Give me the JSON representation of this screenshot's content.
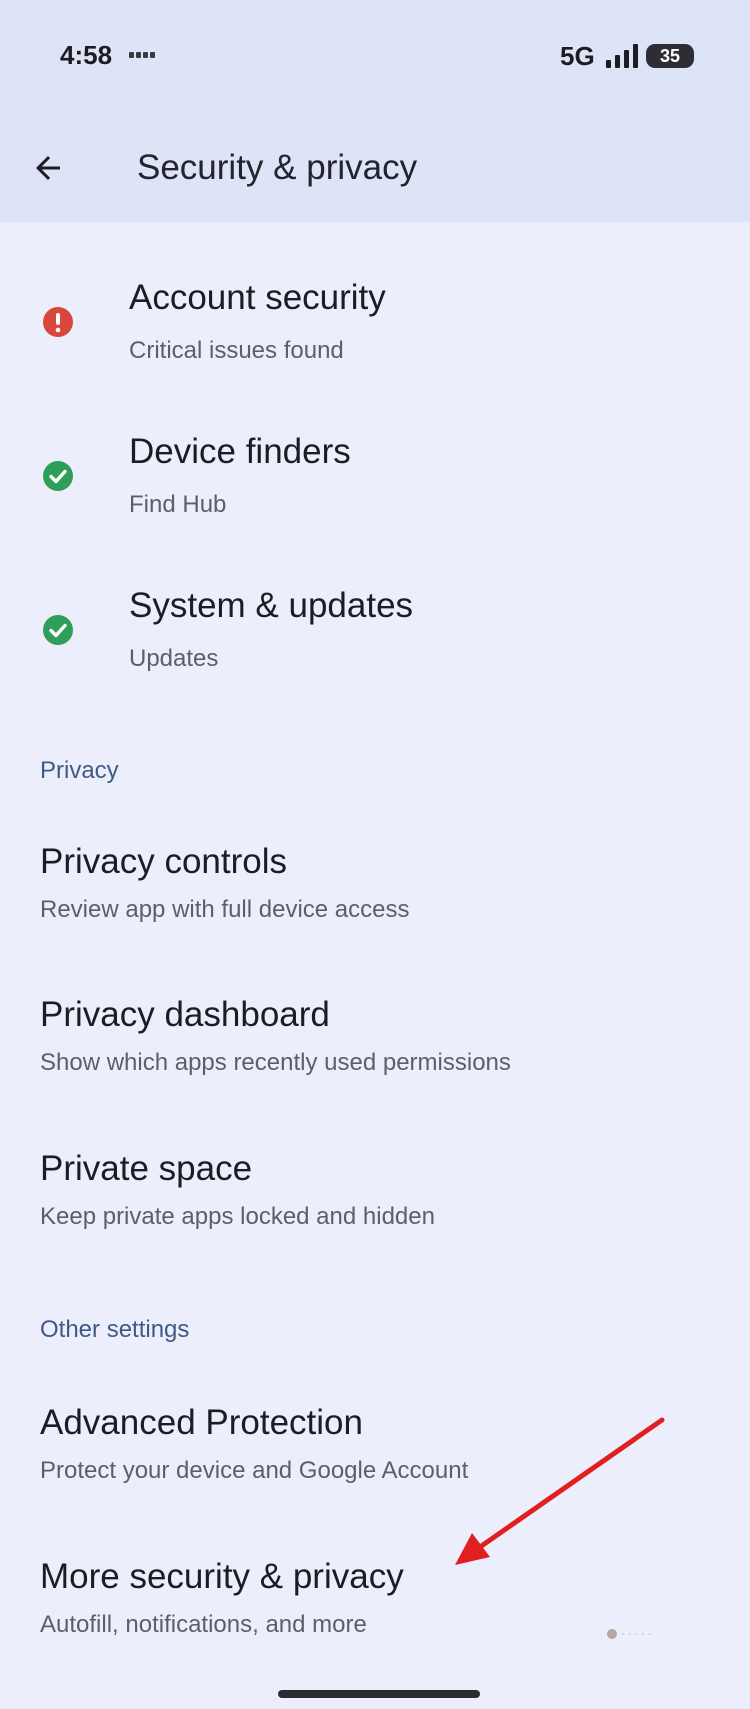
{
  "status_bar": {
    "time": "4:58",
    "network": "5G",
    "battery": "35",
    "icons": [
      "notification-icons",
      "signal-icon",
      "battery-icon"
    ]
  },
  "header": {
    "title": "Security & privacy",
    "back_icon": "arrow-left-icon"
  },
  "status_items": [
    {
      "title": "Account security",
      "subtitle": "Critical issues found",
      "icon": "alert-icon",
      "status_color": "#d9463b"
    },
    {
      "title": "Device finders",
      "subtitle": "Find Hub",
      "icon": "check-circle-icon",
      "status_color": "#2f9e59"
    },
    {
      "title": "System & updates",
      "subtitle": "Updates",
      "icon": "check-circle-icon",
      "status_color": "#2f9e59"
    }
  ],
  "sections": {
    "privacy": {
      "header": "Privacy",
      "items": [
        {
          "title": "Privacy controls",
          "subtitle": "Review app with full device access"
        },
        {
          "title": "Privacy dashboard",
          "subtitle": "Show which apps recently used permissions"
        },
        {
          "title": "Private space",
          "subtitle": "Keep private apps locked and hidden"
        }
      ]
    },
    "other": {
      "header": "Other settings",
      "items": [
        {
          "title": "Advanced Protection",
          "subtitle": "Protect your device and Google Account"
        },
        {
          "title": "More security & privacy",
          "subtitle": "Autofill, notifications, and more"
        }
      ]
    }
  },
  "annotation": {
    "arrow_color": "#e02020"
  },
  "colors": {
    "background": "#eceefb",
    "top_bar": "#dde4f8",
    "section_header": "#3f5a86"
  }
}
